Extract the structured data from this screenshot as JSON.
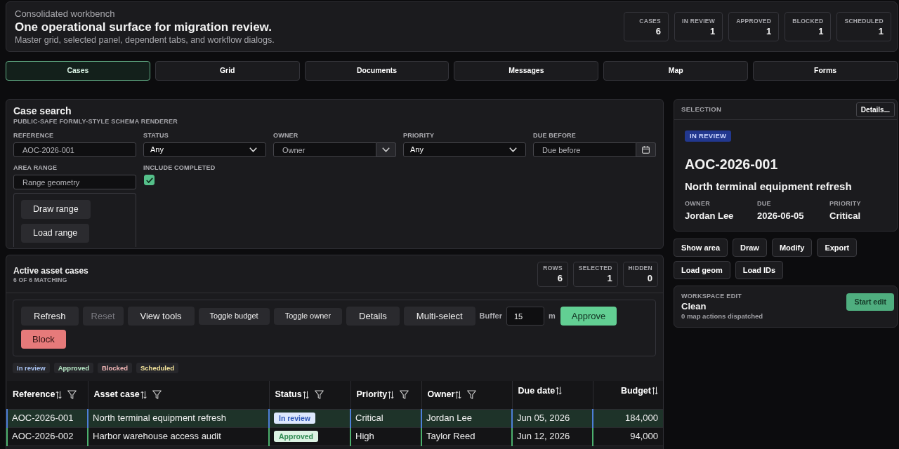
{
  "header": {
    "eyebrow": "Consolidated workbench",
    "title": "One operational surface for migration review.",
    "subtitle": "Master grid, selected panel, dependent tabs, and workflow dialogs.",
    "stats": [
      {
        "label": "CASES",
        "value": "6"
      },
      {
        "label": "IN REVIEW",
        "value": "1"
      },
      {
        "label": "APPROVED",
        "value": "1"
      },
      {
        "label": "BLOCKED",
        "value": "1"
      },
      {
        "label": "SCHEDULED",
        "value": "1"
      }
    ]
  },
  "tabs": [
    {
      "label": "Cases",
      "selected": true
    },
    {
      "label": "Grid",
      "selected": false
    },
    {
      "label": "Documents",
      "selected": false
    },
    {
      "label": "Messages",
      "selected": false
    },
    {
      "label": "Map",
      "selected": false
    },
    {
      "label": "Forms",
      "selected": false
    }
  ],
  "case_search": {
    "title": "Case search",
    "subtitle": "PUBLIC-SAFE FORMLY-STYLE SCHEMA RENDERER",
    "fields": [
      {
        "kind": "text",
        "label": "REFERENCE",
        "placeholder": "AOC-2026-001"
      },
      {
        "kind": "select",
        "label": "STATUS",
        "value": "Any"
      },
      {
        "kind": "combo",
        "label": "OWNER",
        "placeholder": "Owner"
      },
      {
        "kind": "select",
        "label": "PRIORITY",
        "value": "Any"
      },
      {
        "kind": "date",
        "label": "DUE BEFORE",
        "placeholder": "Due before"
      },
      {
        "kind": "range",
        "label": "AREA RANGE",
        "placeholder": "Range geometry",
        "buttons": [
          "Draw range",
          "Load range"
        ]
      },
      {
        "kind": "checkbox",
        "label": "INCLUDE COMPLETED",
        "checked": true
      }
    ]
  },
  "selection": {
    "title": "SELECTION",
    "button": "Details...",
    "badge": "IN REVIEW",
    "reference": "AOC-2026-001",
    "name": "North terminal equipment refresh",
    "meta": [
      {
        "label": "OWNER",
        "value": "Jordan Lee"
      },
      {
        "label": "DUE",
        "value": "2026-06-05"
      },
      {
        "label": "PRIORITY",
        "value": "Critical"
      }
    ]
  },
  "actions": [
    "Show area",
    "Draw",
    "Modify",
    "Export",
    "Load geom",
    "Load IDs"
  ],
  "workspace_edit": {
    "label": "WORKSPACE EDIT",
    "state": "Clean",
    "note": "0 map actions dispatched",
    "button": "Start edit"
  },
  "asset_cases": {
    "title": "Active asset cases",
    "subtitle": "6 OF 6 MATCHING",
    "stats": [
      {
        "label": "ROWS",
        "value": "6"
      },
      {
        "label": "SELECTED",
        "value": "1"
      },
      {
        "label": "HIDDEN",
        "value": "0"
      }
    ],
    "toolbar": [
      {
        "kind": "button",
        "label": "Refresh",
        "disabled": false
      },
      {
        "kind": "button",
        "label": "Reset",
        "disabled": true
      },
      {
        "kind": "button",
        "label": "View tools",
        "disabled": false
      },
      {
        "kind": "compact",
        "label": "Toggle budget",
        "disabled": false
      },
      {
        "kind": "compact",
        "label": "Toggle owner",
        "disabled": false
      },
      {
        "kind": "button",
        "label": "Details",
        "disabled": false
      },
      {
        "kind": "button",
        "label": "Multi-select",
        "disabled": false
      },
      {
        "kind": "field",
        "label": "Buffer",
        "value": "15",
        "unit": "m",
        "disabled": false
      },
      {
        "kind": "success",
        "label": "Approve",
        "disabled": false
      },
      {
        "kind": "danger",
        "label": "Block",
        "disabled": false
      }
    ],
    "legend": [
      {
        "label": "In review",
        "color": "#a9c3f3"
      },
      {
        "label": "Approved",
        "color": "#b7e9c7"
      },
      {
        "label": "Blocked",
        "color": "#f2b6b6"
      },
      {
        "label": "Scheduled",
        "color": "#f3e39a"
      }
    ],
    "table": {
      "columns": [
        {
          "label": "Reference",
          "filter": true
        },
        {
          "label": "Asset case",
          "filter": true
        },
        {
          "label": "Status",
          "filter": true
        },
        {
          "label": "Priority",
          "filter": true
        },
        {
          "label": "Owner",
          "filter": true
        },
        {
          "label": "Due date",
          "filter": false
        },
        {
          "label": "Budget",
          "filter": false
        }
      ],
      "rows": [
        {
          "kind": "review",
          "selected": true,
          "cells": [
            "AOC-2026-001",
            "North terminal equipment refresh",
            "In review",
            "Critical",
            "Jordan Lee",
            "Jun 05, 2026",
            "184,000"
          ]
        },
        {
          "kind": "approved",
          "selected": false,
          "cells": [
            "AOC-2026-002",
            "Harbor warehouse access audit",
            "Approved",
            "High",
            "Taylor Reed",
            "Jun 12, 2026",
            "94,000"
          ]
        }
      ]
    }
  }
}
